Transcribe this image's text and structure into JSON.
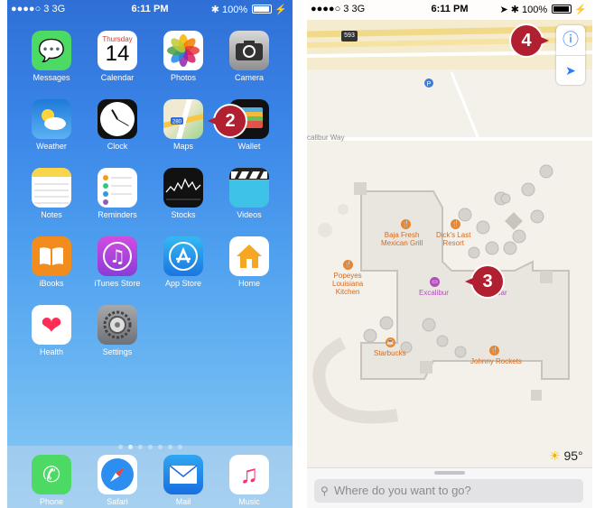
{
  "left_phone": {
    "status": {
      "carrier": "●●●●○ 3  3G",
      "time": "6:11 PM",
      "battery": "100%"
    },
    "apps": [
      {
        "label": "Messages"
      },
      {
        "label": "Calendar"
      },
      {
        "label": "Photos"
      },
      {
        "label": "Camera"
      },
      {
        "label": "Weather"
      },
      {
        "label": "Clock"
      },
      {
        "label": "Maps"
      },
      {
        "label": "Wallet"
      },
      {
        "label": "Notes"
      },
      {
        "label": "Reminders"
      },
      {
        "label": "Stocks"
      },
      {
        "label": "Videos"
      },
      {
        "label": "iBooks"
      },
      {
        "label": "iTunes Store"
      },
      {
        "label": "App Store"
      },
      {
        "label": "Home"
      },
      {
        "label": "Health"
      },
      {
        "label": "Settings"
      }
    ],
    "calendar_day": "Thursday",
    "calendar_date": "14",
    "maps_badge": "280",
    "dock": [
      {
        "label": "Phone"
      },
      {
        "label": "Safari"
      },
      {
        "label": "Mail"
      },
      {
        "label": "Music"
      }
    ]
  },
  "right_phone": {
    "status": {
      "carrier": "●●●●○ 3  3G",
      "time": "6:11 PM",
      "battery": "100%"
    },
    "road_shield": "593",
    "street": "calibur Way",
    "places": {
      "baja": "Baja Fresh\nMexican Grill",
      "dicks": "Dick's Last\nResort",
      "popeyes": "Popeyes\nLouisiana\nKitchen",
      "excalibur": "Excalibur",
      "bar": "y Bar",
      "starbucks": "Starbucks",
      "johnny": "Johnny Rockets"
    },
    "weather": "95°",
    "search_placeholder": "Where do you want to go?"
  },
  "callouts": [
    "2",
    "3",
    "4"
  ]
}
